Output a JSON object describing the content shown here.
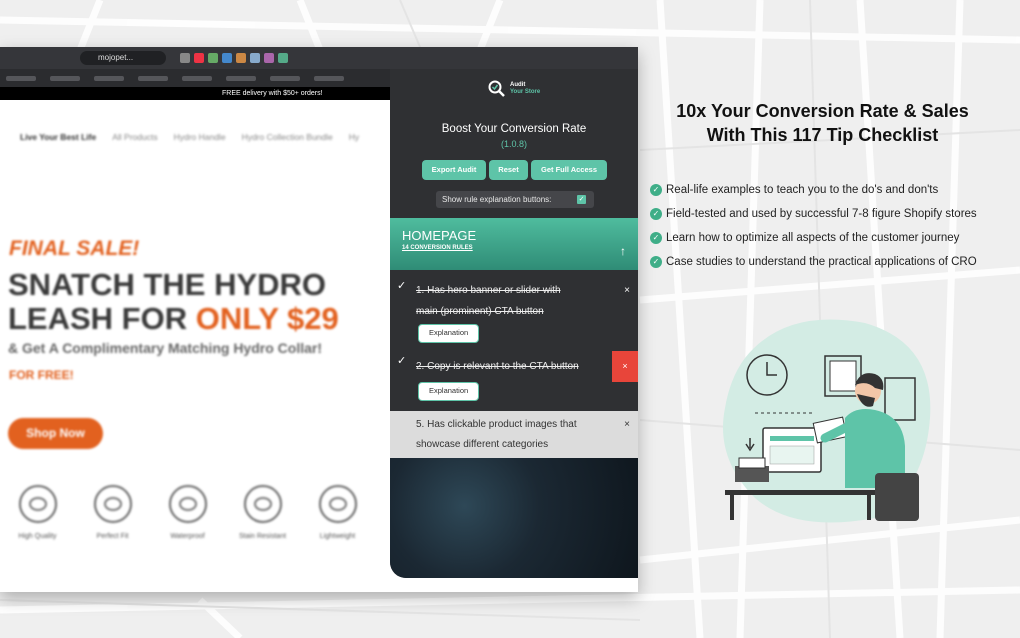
{
  "browser": {
    "url": "mojopet...",
    "announcement": "FREE delivery with $50+ orders!"
  },
  "store": {
    "nav": [
      "Live Your Best Life",
      "All Products",
      "Hydro Handle",
      "Hydro Collection Bundle",
      "Hy"
    ],
    "final_sale": "FINAL SALE!",
    "headline_line1": "SNATCH THE HYDRO",
    "headline_line2_prefix": "LEASH FOR ",
    "headline_line2_highlight": "ONLY $29",
    "subline": "& Get A Complimentary Matching Hydro Collar!",
    "free": "FOR FREE!",
    "shop_button": "Shop Now",
    "features": [
      "High Quality",
      "Perfect Fit",
      "Waterproof",
      "Stain Resistant",
      "Lightweight"
    ]
  },
  "panel": {
    "logo_line1": "Audit",
    "logo_line2": "Your Store",
    "title": "Boost Your Conversion Rate",
    "version": "(1.0.8)",
    "buttons": {
      "export": "Export Audit",
      "reset": "Reset",
      "full_access": "Get Full Access"
    },
    "toggle_label": "Show rule explanation buttons:",
    "section_title": "HOMEPAGE",
    "section_sub": "14 CONVERSION RULES",
    "rule1_line1": "1. Has hero banner or slider with",
    "rule1_line2": "main (prominent) CTA button",
    "rule2": "2. Copy is relevant to the CTA button",
    "rule5_line1": "5. Has clickable product images that",
    "rule5_line2": "showcase different categories",
    "explanation_label": "Explanation",
    "close_glyph": "×",
    "check_glyph": "✓"
  },
  "marketing": {
    "title_line1": "10x Your Conversion Rate & Sales",
    "title_line2": "With This 117 Tip Checklist",
    "bullets": [
      "Real-life examples to teach you to the do's and don'ts",
      "Field-tested and used by successful 7-8 figure Shopify stores",
      "Learn how to optimize all aspects of the customer journey",
      "Case studies to understand the practical applications of CRO"
    ]
  },
  "colors": {
    "accent": "#5ec4a8",
    "brand_orange": "#e2611f",
    "panel_bg": "#2f3033",
    "danger": "#e8453a"
  }
}
